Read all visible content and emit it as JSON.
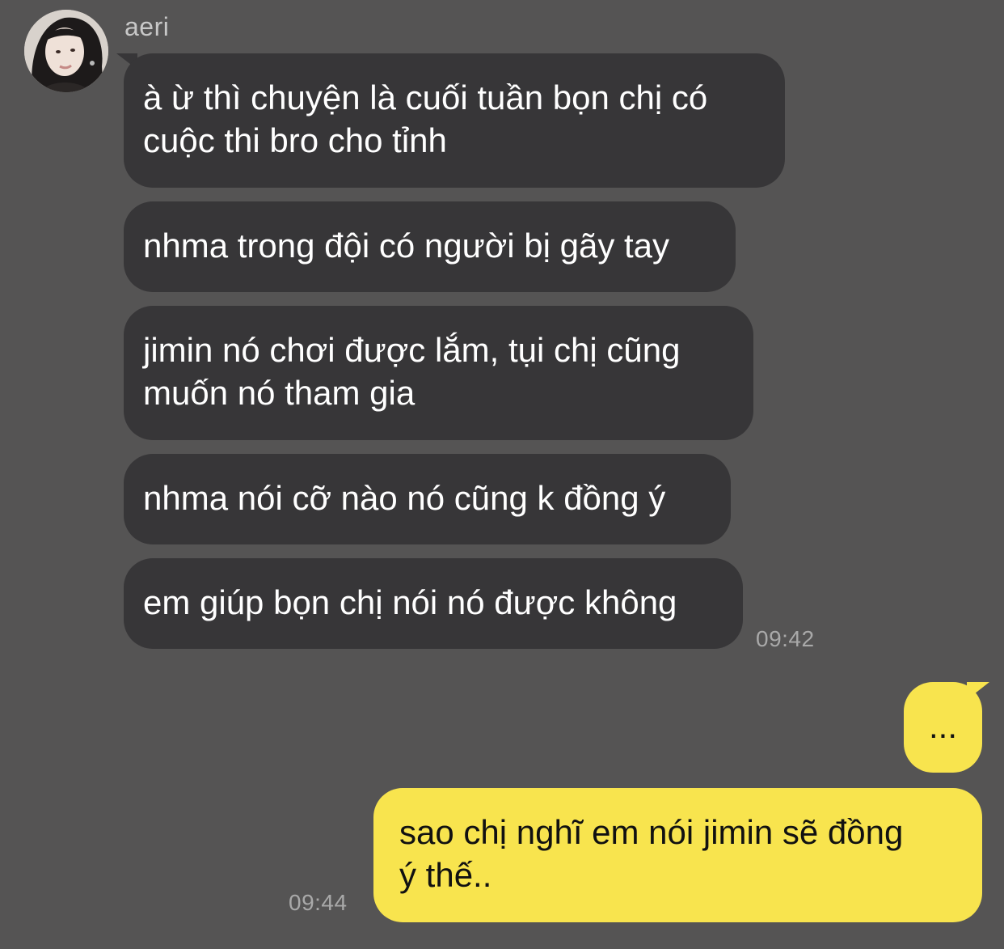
{
  "contact": {
    "name": "aeri",
    "avatar_icon": "profile-photo"
  },
  "incoming": [
    {
      "lines": [
        "à ừ thì chuyện là cuối tuần bọn chị có",
        "cuộc thi bro cho tỉnh"
      ]
    },
    {
      "lines": [
        "nhma trong đội có người bị gãy tay"
      ]
    },
    {
      "lines": [
        "jimin nó chơi được lắm, tụi chị cũng",
        "muốn nó tham gia"
      ]
    },
    {
      "lines": [
        "nhma nói cỡ nào nó cũng k đồng ý"
      ]
    },
    {
      "lines": [
        "em giúp bọn chị nói nó được không"
      ]
    }
  ],
  "incoming_time": "09:42",
  "outgoing": [
    {
      "lines": [
        "..."
      ]
    },
    {
      "lines": [
        "sao chị nghĩ em nói jimin sẽ đồng",
        "ý thế.."
      ]
    }
  ],
  "outgoing_time": "09:44",
  "colors": {
    "background": "#555454",
    "incoming_bubble": "#373638",
    "outgoing_bubble": "#f8e44e"
  }
}
